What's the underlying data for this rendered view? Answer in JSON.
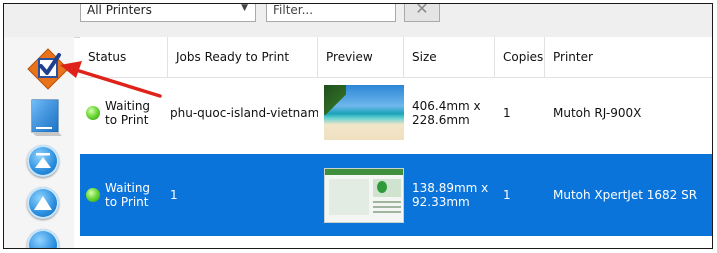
{
  "filter_bar": {
    "printer_select_value": "All Printers",
    "filter_placeholder": "Filter..."
  },
  "columns": [
    "Status",
    "Jobs Ready to Print",
    "Preview",
    "Size",
    "Copies",
    "Printer"
  ],
  "jobs": [
    {
      "status": "Waiting to Print",
      "job": "phu-quoc-island-vietnam",
      "size": "406.4mm x 228.6mm",
      "copies": "1",
      "printer": "Mutoh RJ-900X",
      "selected": false
    },
    {
      "status": "Waiting to Print",
      "job": "1",
      "size": "138.89mm x 92.33mm",
      "copies": "1",
      "printer": "Mutoh XpertJet 1682 SR",
      "selected": true
    }
  ],
  "icons": {
    "toolbar": [
      "checklist-icon",
      "page-icon",
      "move-to-top-icon",
      "move-up-icon"
    ],
    "status": "status-green-dot-icon"
  },
  "colors": {
    "selection": "#0a74da",
    "annotation_arrow": "#e0231a"
  }
}
